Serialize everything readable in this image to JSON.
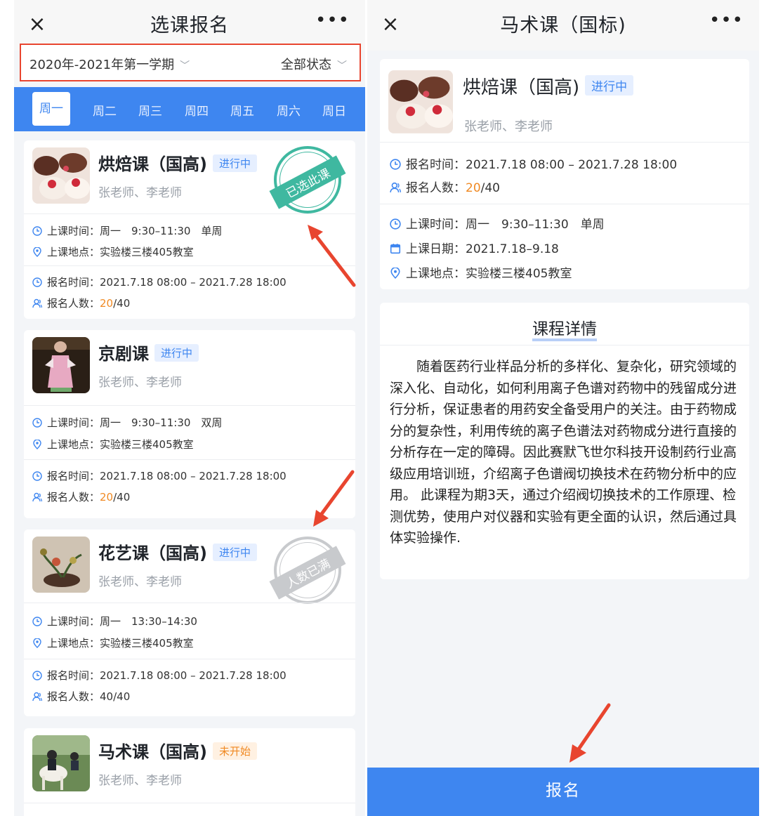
{
  "left": {
    "title": "选课报名",
    "close_icon": "×",
    "more_icon": "•••",
    "filter": {
      "term": "2020年-2021年第一学期",
      "status": "全部状态"
    },
    "days": [
      "周一",
      "周二",
      "周三",
      "周四",
      "周五",
      "周六",
      "周日"
    ],
    "courses": [
      {
        "name": "烘焙课（国高)",
        "status": "进行中",
        "teachers": "张老师、李老师",
        "class_time": "上课时间：周一　9:30–11:30　单周",
        "location": "上课地点：实验楼三楼405教室",
        "signup_time": "报名时间：2021.7.18 08:00 – 2021.7.28 18:00",
        "count_label": "报名人数：",
        "count_current": "20",
        "count_total": "/40",
        "stamp": "已选此课"
      },
      {
        "name": "京剧课",
        "status": "进行中",
        "teachers": "张老师、李老师",
        "class_time": "上课时间：周一　9:30–11:30　双周",
        "location": "上课地点：实验楼三楼405教室",
        "signup_time": "报名时间：2021.7.18 08:00 – 2021.7.28 18:00",
        "count_label": "报名人数：",
        "count_current": "20",
        "count_total": "/40"
      },
      {
        "name": "花艺课（国高)",
        "status": "进行中",
        "teachers": "张老师、李老师",
        "class_time": "上课时间：周一　13:30–14:30",
        "location": "上课地点：实验楼三楼405教室",
        "signup_time": "报名时间：2021.7.18 08:00 – 2021.7.28 18:00",
        "count_label": "报名人数：",
        "count_full": "40/40",
        "stamp": "人数已满"
      },
      {
        "name": "马术课（国高)",
        "status": "未开始",
        "teachers": "张老师、李老师"
      }
    ]
  },
  "right": {
    "title": "马术课（国标)",
    "close_icon": "×",
    "more_icon": "•••",
    "course": {
      "name": "烘焙课（国高)",
      "status": "进行中",
      "teachers": "张老师、李老师",
      "signup_time": "报名时间：2021.7.18 08:00 – 2021.7.28 18:00",
      "count_label": "报名人数：",
      "count_current": "20",
      "count_total": "/40",
      "class_time": "上课时间：周一　9:30–11:30　单周",
      "class_date": "上课日期：2021.7.18–9.18",
      "location": "上课地点：实验楼三楼405教室"
    },
    "detail_title": "课程详情",
    "detail_body": "随着医药行业样品分析的多样化、复杂化，研究领域的深入化、自动化，如何利用离子色谱对药物中的残留成分进行分析，保证患者的用药安全备受用户的关注。由于药物成分的复杂性，利用传统的离子色谱法对药物成分进行直接的分析存在一定的障碍。因此赛默飞世尔科技开设制药行业高级应用培训班，介绍离子色谱阀切换技术在药物分析中的应用。 此课程为期3天，通过介绍阀切换技术的工作原理、检测优势，使用户对仪器和实验有更全面的认识，然后通过具体实验操作.",
    "signup_button": "报名"
  },
  "colors": {
    "accent": "#3e86f0",
    "orange": "#f08a24",
    "annotation_red": "#e8452f",
    "stamp_green": "#3fb8a0",
    "stamp_gray": "#c8cacd"
  }
}
